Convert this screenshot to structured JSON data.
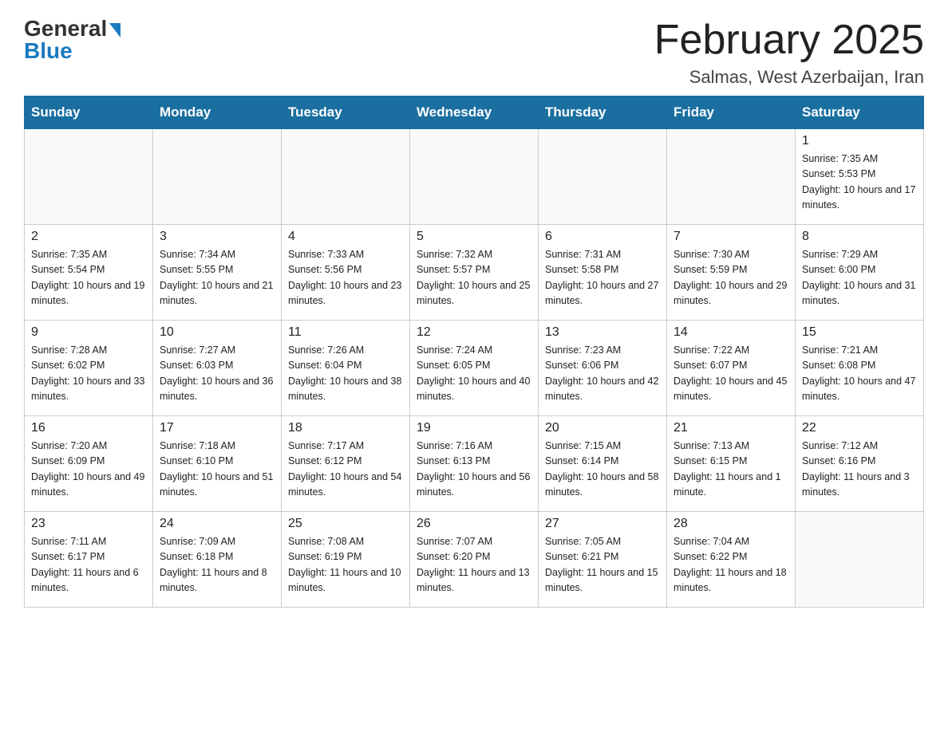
{
  "header": {
    "logo_general": "General",
    "logo_blue": "Blue",
    "title": "February 2025",
    "subtitle": "Salmas, West Azerbaijan, Iran"
  },
  "days_of_week": [
    "Sunday",
    "Monday",
    "Tuesday",
    "Wednesday",
    "Thursday",
    "Friday",
    "Saturday"
  ],
  "weeks": [
    [
      {
        "day": "",
        "info": ""
      },
      {
        "day": "",
        "info": ""
      },
      {
        "day": "",
        "info": ""
      },
      {
        "day": "",
        "info": ""
      },
      {
        "day": "",
        "info": ""
      },
      {
        "day": "",
        "info": ""
      },
      {
        "day": "1",
        "info": "Sunrise: 7:35 AM\nSunset: 5:53 PM\nDaylight: 10 hours and 17 minutes."
      }
    ],
    [
      {
        "day": "2",
        "info": "Sunrise: 7:35 AM\nSunset: 5:54 PM\nDaylight: 10 hours and 19 minutes."
      },
      {
        "day": "3",
        "info": "Sunrise: 7:34 AM\nSunset: 5:55 PM\nDaylight: 10 hours and 21 minutes."
      },
      {
        "day": "4",
        "info": "Sunrise: 7:33 AM\nSunset: 5:56 PM\nDaylight: 10 hours and 23 minutes."
      },
      {
        "day": "5",
        "info": "Sunrise: 7:32 AM\nSunset: 5:57 PM\nDaylight: 10 hours and 25 minutes."
      },
      {
        "day": "6",
        "info": "Sunrise: 7:31 AM\nSunset: 5:58 PM\nDaylight: 10 hours and 27 minutes."
      },
      {
        "day": "7",
        "info": "Sunrise: 7:30 AM\nSunset: 5:59 PM\nDaylight: 10 hours and 29 minutes."
      },
      {
        "day": "8",
        "info": "Sunrise: 7:29 AM\nSunset: 6:00 PM\nDaylight: 10 hours and 31 minutes."
      }
    ],
    [
      {
        "day": "9",
        "info": "Sunrise: 7:28 AM\nSunset: 6:02 PM\nDaylight: 10 hours and 33 minutes."
      },
      {
        "day": "10",
        "info": "Sunrise: 7:27 AM\nSunset: 6:03 PM\nDaylight: 10 hours and 36 minutes."
      },
      {
        "day": "11",
        "info": "Sunrise: 7:26 AM\nSunset: 6:04 PM\nDaylight: 10 hours and 38 minutes."
      },
      {
        "day": "12",
        "info": "Sunrise: 7:24 AM\nSunset: 6:05 PM\nDaylight: 10 hours and 40 minutes."
      },
      {
        "day": "13",
        "info": "Sunrise: 7:23 AM\nSunset: 6:06 PM\nDaylight: 10 hours and 42 minutes."
      },
      {
        "day": "14",
        "info": "Sunrise: 7:22 AM\nSunset: 6:07 PM\nDaylight: 10 hours and 45 minutes."
      },
      {
        "day": "15",
        "info": "Sunrise: 7:21 AM\nSunset: 6:08 PM\nDaylight: 10 hours and 47 minutes."
      }
    ],
    [
      {
        "day": "16",
        "info": "Sunrise: 7:20 AM\nSunset: 6:09 PM\nDaylight: 10 hours and 49 minutes."
      },
      {
        "day": "17",
        "info": "Sunrise: 7:18 AM\nSunset: 6:10 PM\nDaylight: 10 hours and 51 minutes."
      },
      {
        "day": "18",
        "info": "Sunrise: 7:17 AM\nSunset: 6:12 PM\nDaylight: 10 hours and 54 minutes."
      },
      {
        "day": "19",
        "info": "Sunrise: 7:16 AM\nSunset: 6:13 PM\nDaylight: 10 hours and 56 minutes."
      },
      {
        "day": "20",
        "info": "Sunrise: 7:15 AM\nSunset: 6:14 PM\nDaylight: 10 hours and 58 minutes."
      },
      {
        "day": "21",
        "info": "Sunrise: 7:13 AM\nSunset: 6:15 PM\nDaylight: 11 hours and 1 minute."
      },
      {
        "day": "22",
        "info": "Sunrise: 7:12 AM\nSunset: 6:16 PM\nDaylight: 11 hours and 3 minutes."
      }
    ],
    [
      {
        "day": "23",
        "info": "Sunrise: 7:11 AM\nSunset: 6:17 PM\nDaylight: 11 hours and 6 minutes."
      },
      {
        "day": "24",
        "info": "Sunrise: 7:09 AM\nSunset: 6:18 PM\nDaylight: 11 hours and 8 minutes."
      },
      {
        "day": "25",
        "info": "Sunrise: 7:08 AM\nSunset: 6:19 PM\nDaylight: 11 hours and 10 minutes."
      },
      {
        "day": "26",
        "info": "Sunrise: 7:07 AM\nSunset: 6:20 PM\nDaylight: 11 hours and 13 minutes."
      },
      {
        "day": "27",
        "info": "Sunrise: 7:05 AM\nSunset: 6:21 PM\nDaylight: 11 hours and 15 minutes."
      },
      {
        "day": "28",
        "info": "Sunrise: 7:04 AM\nSunset: 6:22 PM\nDaylight: 11 hours and 18 minutes."
      },
      {
        "day": "",
        "info": ""
      }
    ]
  ]
}
